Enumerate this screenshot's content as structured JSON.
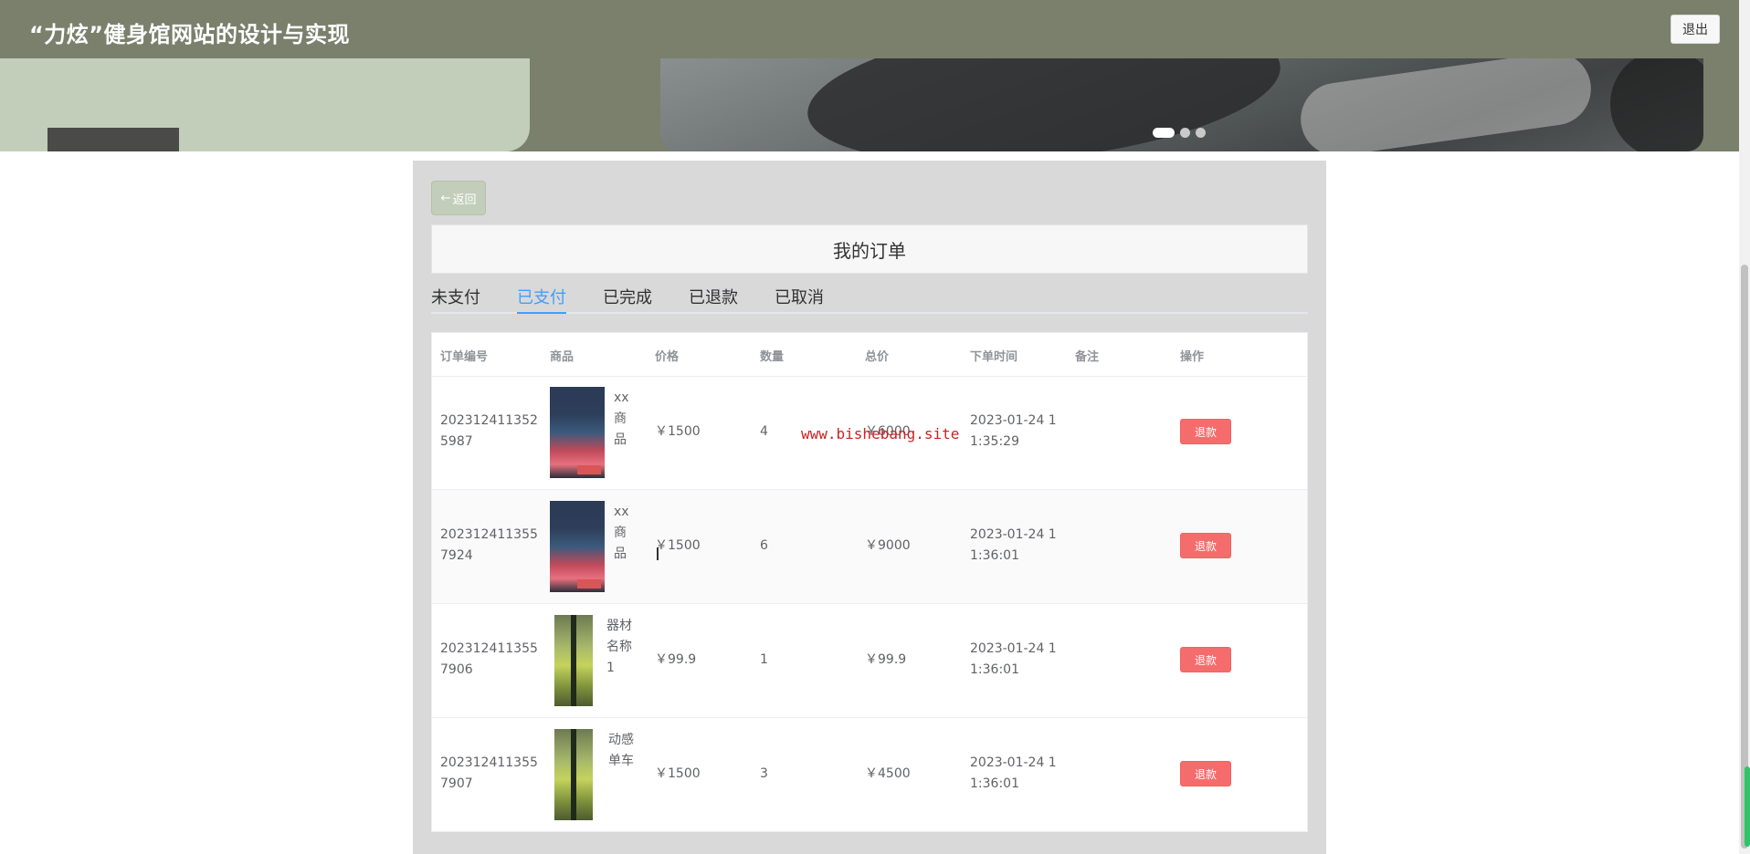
{
  "header": {
    "title": "“力炫”健身馆网站的设计与实现",
    "logout_label": "退出"
  },
  "banner": {
    "dots": [
      {
        "active": true
      },
      {
        "active": false
      },
      {
        "active": false
      }
    ]
  },
  "back_button": {
    "arrow": "←",
    "label": "返回"
  },
  "page_title": "我的订单",
  "tabs": [
    {
      "label": "未支付",
      "active": false
    },
    {
      "label": "已支付",
      "active": true
    },
    {
      "label": "已完成",
      "active": false
    },
    {
      "label": "已退款",
      "active": false
    },
    {
      "label": "已取消",
      "active": false
    }
  ],
  "table": {
    "columns": [
      "订单编号",
      "商品",
      "价格",
      "数量",
      "总价",
      "下单时间",
      "备注",
      "操作"
    ],
    "rows": [
      {
        "order_no": [
          "202312411352",
          "5987"
        ],
        "product_name": [
          "xx",
          "商",
          "品"
        ],
        "image": "product-photo-a",
        "price": "￥1500",
        "quantity": "4",
        "total": "￥6000",
        "time": [
          "2023-01-24 1",
          "1:35:29"
        ],
        "note": "",
        "action": "退款"
      },
      {
        "order_no": [
          "202312411355",
          "7924"
        ],
        "product_name": [
          "xx",
          "商",
          "品"
        ],
        "image": "product-photo-a",
        "price": "￥1500",
        "quantity": "6",
        "total": "￥9000",
        "time": [
          "2023-01-24 1",
          "1:36:01"
        ],
        "note": "",
        "action": "退款"
      },
      {
        "order_no": [
          "202312411355",
          "7906"
        ],
        "product_name": [
          "器材",
          "名称",
          "1"
        ],
        "image": "product-photo-b",
        "price": "￥99.9",
        "quantity": "1",
        "total": "￥99.9",
        "time": [
          "2023-01-24 1",
          "1:36:01"
        ],
        "note": "",
        "action": "退款"
      },
      {
        "order_no": [
          "202312411355",
          "7907"
        ],
        "product_name": [
          "动感",
          "单车"
        ],
        "image": "product-photo-b",
        "price": "￥1500",
        "quantity": "3",
        "total": "￥4500",
        "time": [
          "2023-01-24 1",
          "1:36:01"
        ],
        "note": "",
        "action": "退款"
      }
    ]
  },
  "watermark": "www.bishebang.site",
  "colors": {
    "header_bg": "#7a806c",
    "banner_card": "#c3ceba",
    "tab_active": "#409eff",
    "refund_button": "#f56c6c",
    "watermark": "#cc2222"
  }
}
